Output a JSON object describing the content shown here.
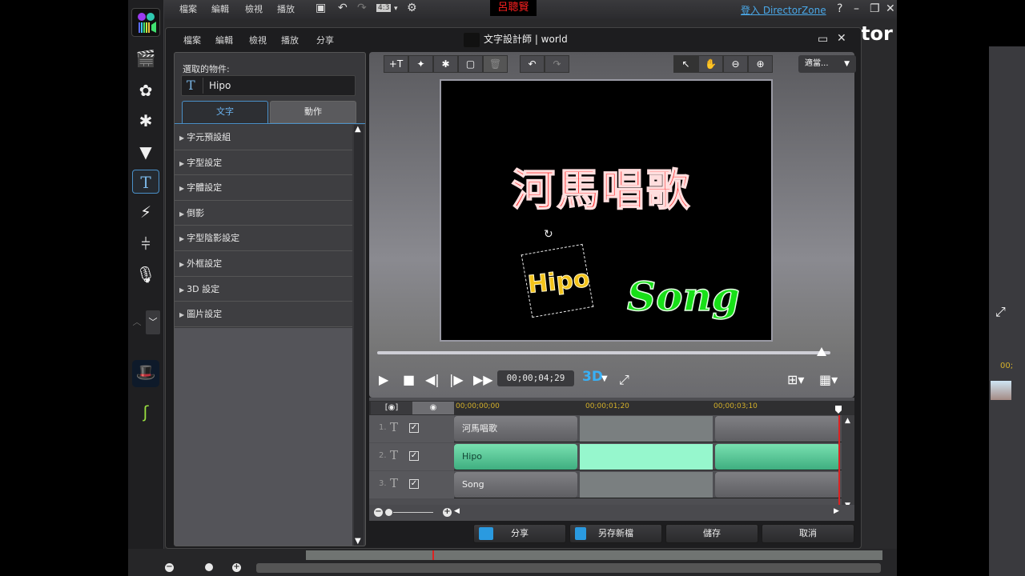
{
  "app": {
    "menu": [
      "檔案",
      "編輯",
      "檢視",
      "播放"
    ],
    "aspect_ratio": "4:3",
    "project_title_redacted": "呂聰賢",
    "directorzone_link": "登入 DirectorZone",
    "partial_title": "tor",
    "sidebar_icons": [
      "app-logo-icon",
      "clapboard-icon",
      "flower-icon",
      "particle-icon",
      "fireworks-icon",
      "text-icon",
      "transition-icon",
      "mixer-icon",
      "microphone-icon"
    ],
    "sidebar_active": "text-icon"
  },
  "dialog": {
    "menu": [
      "檔案",
      "編輯",
      "檢視",
      "播放",
      "分享"
    ],
    "title": "文字設計師 | world",
    "properties": {
      "selected_label": "選取的物件:",
      "selected_value": "Hipo",
      "tabs": [
        {
          "label": "文字",
          "active": true
        },
        {
          "label": "動作",
          "active": false
        }
      ],
      "sections": [
        "字元預設組",
        "字型設定",
        "字體設定",
        "倒影",
        "字型陰影設定",
        "外框設定",
        "3D 設定",
        "圖片設定"
      ]
    },
    "preview": {
      "zoom_option": "適當...",
      "canvas_texts": [
        {
          "id": "main",
          "text": "河馬唱歌",
          "color": "#ff1a1a"
        },
        {
          "id": "hipo",
          "text": "Hipo",
          "color": "#f3c31a",
          "selected": true
        },
        {
          "id": "song",
          "text": "Song",
          "color": "#18e018"
        }
      ],
      "scrub_position": 0.98,
      "timecode": "00;00;04;29",
      "btn_3d": "3D"
    },
    "timeline": {
      "ruler": [
        "00;00;00;00",
        "00;00;01;20",
        "00;00;03;10"
      ],
      "tracks": [
        {
          "num": "1.",
          "label": "河馬唱歌",
          "checked": true,
          "selected": false
        },
        {
          "num": "2.",
          "label": "Hipo",
          "checked": true,
          "selected": true
        },
        {
          "num": "3.",
          "label": "Song",
          "checked": true,
          "selected": false
        }
      ]
    },
    "actions": {
      "share": "分享",
      "save_as": "另存新檔",
      "save": "儲存",
      "cancel": "取消"
    }
  },
  "right_panel": {
    "time_partial": "00;"
  }
}
